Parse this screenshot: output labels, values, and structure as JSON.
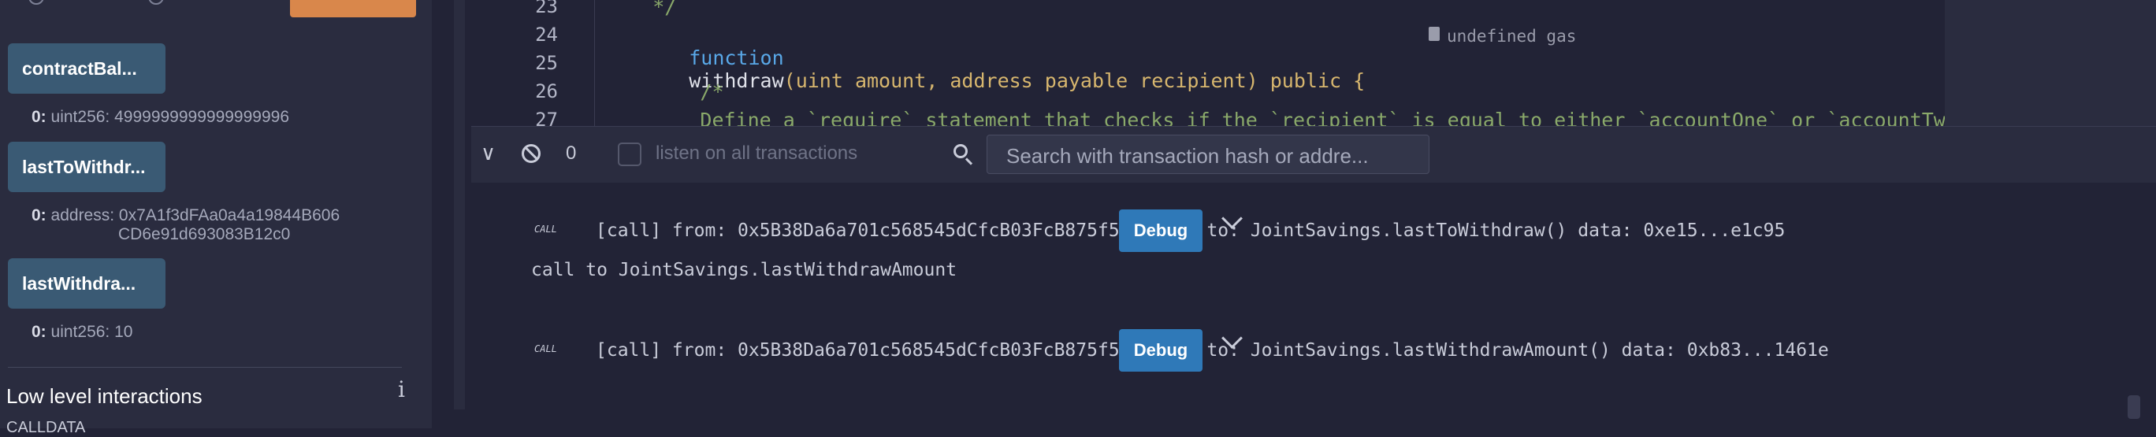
{
  "left_panel": {
    "functions": [
      {
        "label": "contractBal...",
        "output": "uint256: 4999999999999999996",
        "index": "0:"
      },
      {
        "label": "lastToWithdr...",
        "output_line1": "address: 0x7A1f3dFAa0a4a19844B606",
        "output_line2": "CD6e91d693083B12c0",
        "index": "0:"
      },
      {
        "label": "lastWithdra...",
        "output": "uint256: 10",
        "index": "0:"
      }
    ],
    "low_level_title": "Low level interactions",
    "info_icon": "i",
    "calldata_label": "CALLDATA"
  },
  "editor": {
    "lines": [
      {
        "num": "23",
        "text": "    */"
      },
      {
        "num": "24",
        "kw": "function",
        "name": "withdraw",
        "rest": "(uint amount, address payable recipient) public {",
        "gas": "undefined gas"
      },
      {
        "num": "25",
        "text": ""
      },
      {
        "num": "26",
        "text": "        /*"
      },
      {
        "num": "27",
        "text": "        Define a `require` statement that checks if the `recipient` is equal to either `accountOne` or `accountTwo`. Th"
      }
    ]
  },
  "terminal": {
    "tx_count": "0",
    "listen_label": "listen on all transactions",
    "search_placeholder": "Search with transaction hash or addre...",
    "entries": [
      {
        "badge": "CALL",
        "text": "[call] from: 0x5B38Da6a701c568545dCfcB03FcB875f56beddC4 to: JointSavings.lastToWithdraw() data: 0xe15...e1c95",
        "debug": "Debug"
      },
      {
        "badge": "CALL",
        "text": "[call] from: 0x5B38Da6a701c568545dCfcB03FcB875f56beddC4 to: JointSavings.lastWithdrawAmount() data: 0xb83...1461e",
        "debug": "Debug"
      }
    ],
    "plain_line": "call to JointSavings.lastWithdrawAmount"
  },
  "colors": {
    "button_blue": "#2f79b8",
    "fn_button": "#3a5a74",
    "orange": "#d9874b"
  }
}
